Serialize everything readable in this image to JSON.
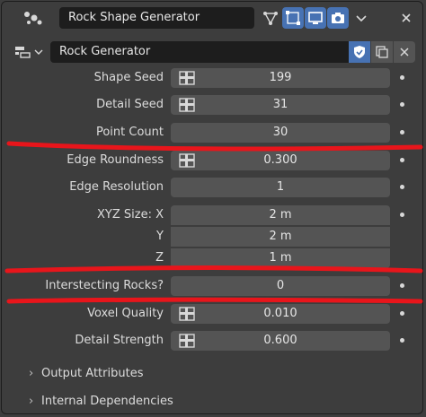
{
  "header": {
    "title": "Rock Shape Generator"
  },
  "node_group": {
    "name": "Rock Generator"
  },
  "properties": [
    {
      "label": "Shape Seed",
      "value": "199",
      "has_socket_icon": true
    },
    {
      "label": "Detail Seed",
      "value": "31",
      "has_socket_icon": true
    },
    {
      "label": "Point Count",
      "value": "30",
      "has_socket_icon": false
    },
    {
      "label": "Edge Roundness",
      "value": "0.300",
      "has_socket_icon": true
    },
    {
      "label": "Edge Resolution",
      "value": "1",
      "has_socket_icon": false
    },
    {
      "label": "XYZ Size: X",
      "value": "2 m",
      "has_socket_icon": false
    },
    {
      "label": "Y",
      "value": "2 m",
      "has_socket_icon": false
    },
    {
      "label": "Z",
      "value": "1 m",
      "has_socket_icon": false
    },
    {
      "label": "Interstecting Rocks?",
      "value": "0",
      "has_socket_icon": false
    },
    {
      "label": "Voxel Quality",
      "value": "0.010",
      "has_socket_icon": true
    },
    {
      "label": "Detail Strength",
      "value": "0.600",
      "has_socket_icon": true
    }
  ],
  "sections": [
    {
      "label": "Output Attributes"
    },
    {
      "label": "Internal Dependencies"
    }
  ],
  "icons": {
    "header": "geometry-nodes-icon",
    "annotation_color": "#e8151b",
    "active_button_color": "#4772b3"
  }
}
